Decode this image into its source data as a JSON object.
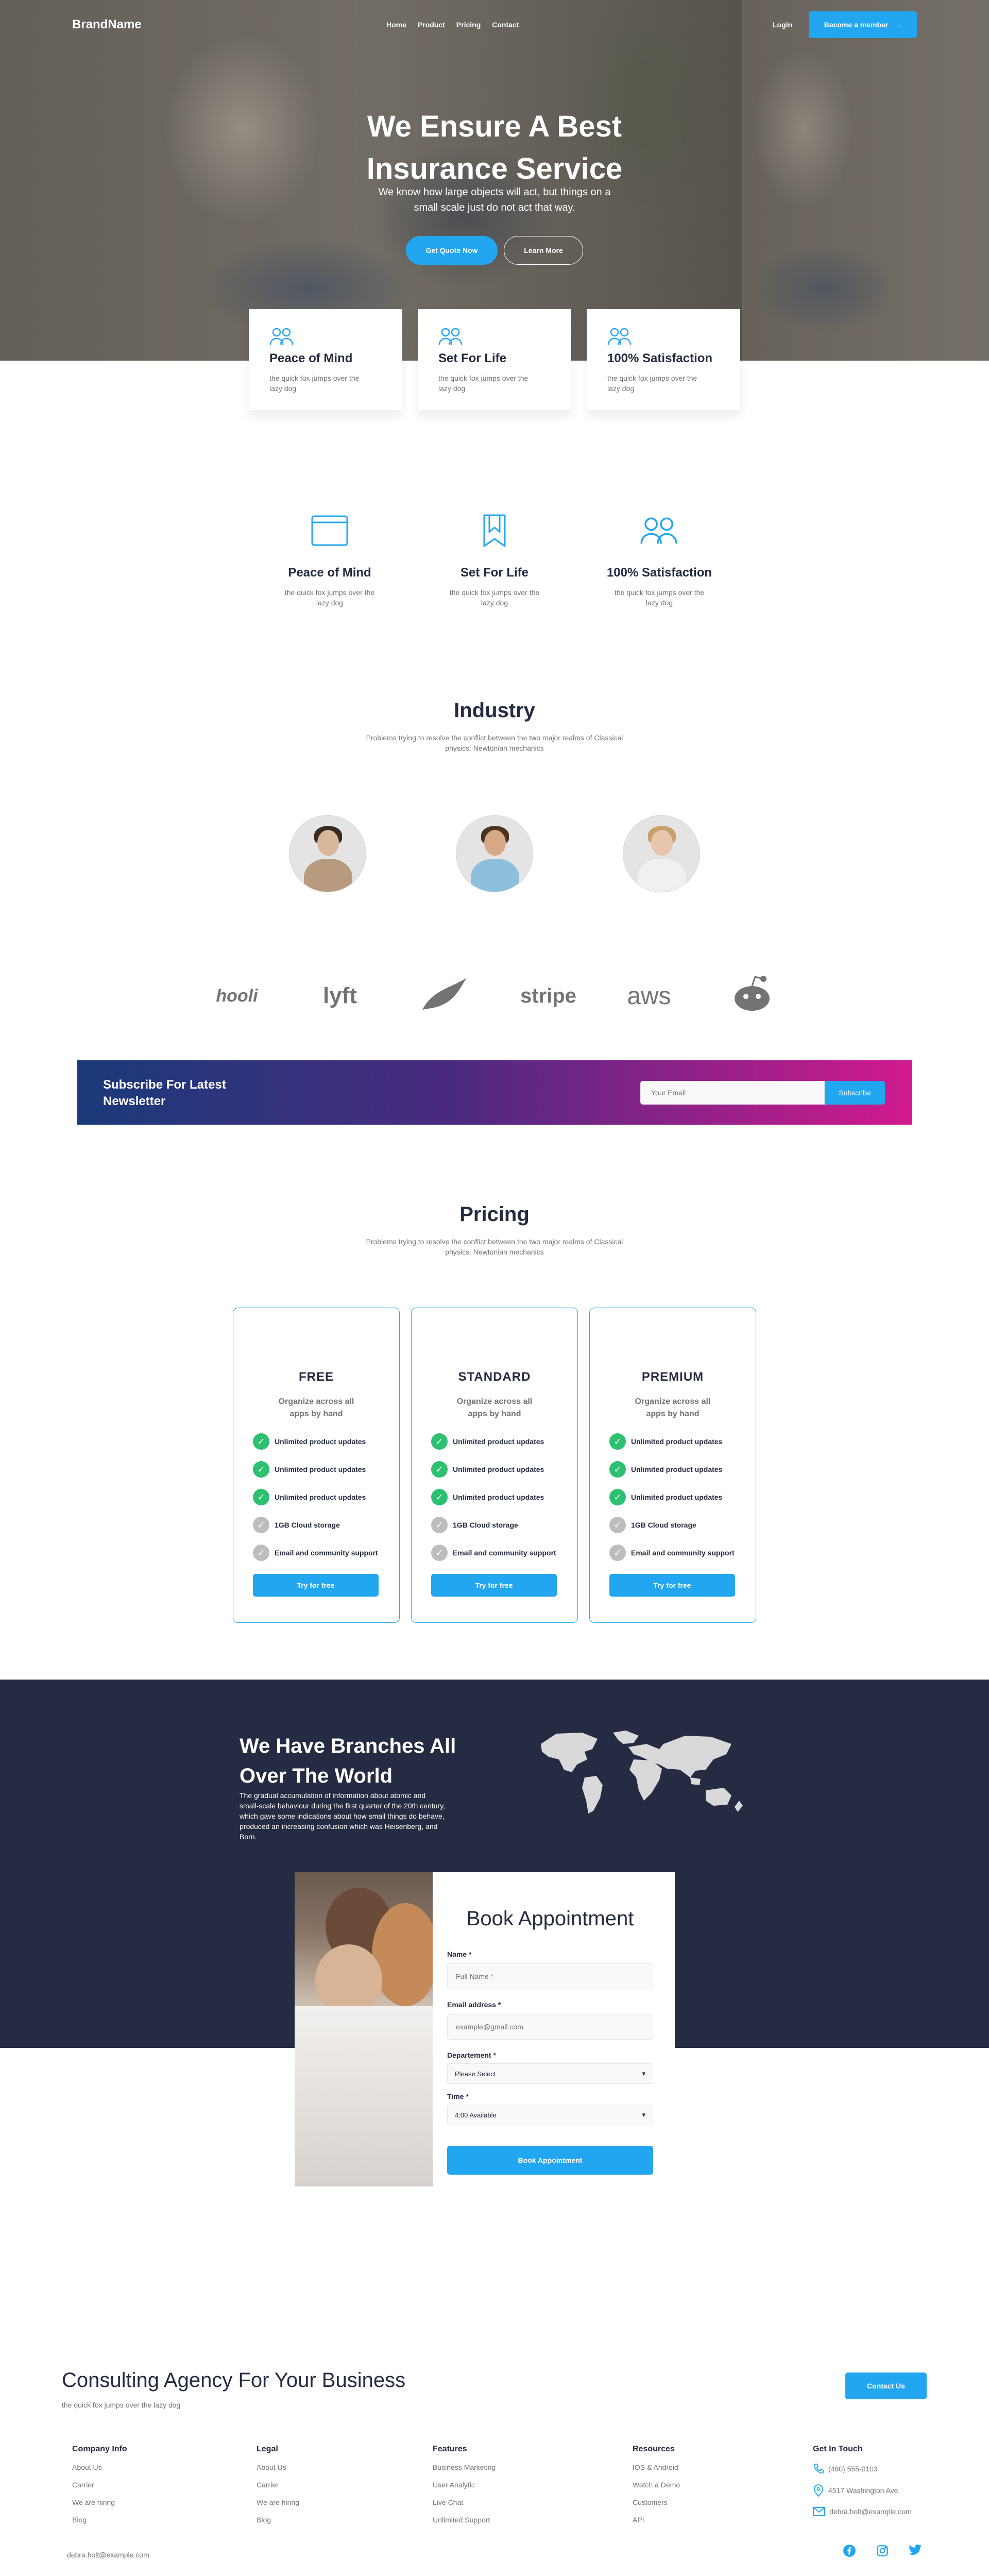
{
  "nav": {
    "brand": "BrandName",
    "menu": [
      "Home",
      "Product",
      "Pricing",
      "Contact"
    ],
    "login": "Login",
    "become_member": "Become a member",
    "become_icon": "arrow-right-icon"
  },
  "hero": {
    "title_line1": "We Ensure A Best",
    "title_line2": "Insurance Service",
    "subtitle": "We know how large objects will act, but things on a small scale just do not act that way.",
    "btn_quote": "Get Quote Now",
    "btn_more": "Learn More"
  },
  "hero_cards": [
    {
      "title": "Peace of Mind",
      "text": "the quick fox jumps over the lazy dog",
      "icon": "users-icon"
    },
    {
      "title": "Set For Life",
      "text": "the quick fox jumps over the lazy dog",
      "icon": "users-icon"
    },
    {
      "title": "100% Satisfaction",
      "text": "the quick fox jumps over the lazy dog",
      "icon": "users-icon"
    }
  ],
  "features": [
    {
      "title": "Peace of Mind",
      "text": "the quick fox jumps over the lazy dog",
      "icon": "browser-icon"
    },
    {
      "title": "Set For Life",
      "text": "the quick fox jumps over the lazy dog",
      "icon": "bookmark-icon"
    },
    {
      "title": "100% Satisfaction",
      "text": "the quick fox jumps over the lazy dog",
      "icon": "users-icon"
    }
  ],
  "industry": {
    "title": "Industry",
    "subtitle": "Problems trying to resolve the conflict between the two major realms of Classical physics: Newtonian mechanics"
  },
  "logos": [
    "hooli",
    "lyft",
    "leaf",
    "stripe",
    "aws",
    "reddit"
  ],
  "newsletter": {
    "title": "Subscribe For Latest Newsletter",
    "placeholder": "Your Email",
    "button": "Subscribe"
  },
  "pricing": {
    "title": "Pricing",
    "subtitle": "Problems trying to resolve the conflict between the two major realms of Classical physics: Newtonian mechanics",
    "plans": [
      {
        "name": "FREE",
        "desc": "Organize across all apps by hand",
        "button": "Try for free",
        "features": [
          "Unlimited product updates",
          "Unlimited product updates",
          "Unlimited product updates",
          "1GB  Cloud storage",
          "Email and community support"
        ]
      },
      {
        "name": "STANDARD",
        "desc": "Organize across all apps by hand",
        "button": "Try for free",
        "features": [
          "Unlimited product updates",
          "Unlimited product updates",
          "Unlimited product updates",
          "1GB  Cloud storage",
          "Email and community support"
        ]
      },
      {
        "name": "PREMIUM",
        "desc": "Organize across all apps by hand",
        "button": "Try for free",
        "features": [
          "Unlimited product updates",
          "Unlimited product updates",
          "Unlimited product updates",
          "1GB  Cloud storage",
          "Email and community support"
        ]
      }
    ],
    "colors": {
      "included": "#2DC071",
      "excluded": "#BDBDBD"
    }
  },
  "branches": {
    "title": "We Have Branches All Over The World",
    "text": "The gradual accumulation of information about atomic and small-scale behaviour during the first quarter of the 20th century, which gave some indications about how small things do behave, produced an increasing confusion which was Heisenberg, and Born."
  },
  "appointment": {
    "title": "Book Appointment",
    "name_label": "Name *",
    "name_placeholder": "Full Name *",
    "email_label": "Email address *",
    "email_placeholder": "example@gmail.com",
    "dept_label": "Departement *",
    "dept_value": "Please Select",
    "time_label": "Time *",
    "time_value": "4:00 Available",
    "button": "Book Appointment"
  },
  "consult": {
    "title": "Consulting Agency For Your Business",
    "subtitle": "the quick fox jumps over the lazy dog",
    "button": "Contact Us"
  },
  "footer": {
    "columns": [
      {
        "title": "Company Info",
        "links": [
          "About Us",
          "Carrier",
          "We are hiring",
          "Blog"
        ]
      },
      {
        "title": "Legal",
        "links": [
          "About Us",
          "Carrier",
          "We are hiring",
          "Blog"
        ]
      },
      {
        "title": "Features",
        "links": [
          "Business Marketing",
          "User Analytic",
          "Live Chat",
          "Unlimited Support"
        ]
      },
      {
        "title": "Resources",
        "links": [
          "IOS & Android",
          "Watch a Demo",
          "Customers",
          "API"
        ]
      }
    ],
    "touch": {
      "title": "Get In Touch",
      "phone": "(480) 555-0103",
      "address": "4517 Washington Ave.",
      "email": "debra.holt@example.com"
    },
    "copyright": "debra.holt@example.com",
    "socials": [
      "facebook-icon",
      "instagram-icon",
      "twitter-icon"
    ]
  },
  "colors": {
    "primary": "#23A6F0",
    "dark": "#252B42",
    "muted": "#737373",
    "success": "#2DC071"
  }
}
